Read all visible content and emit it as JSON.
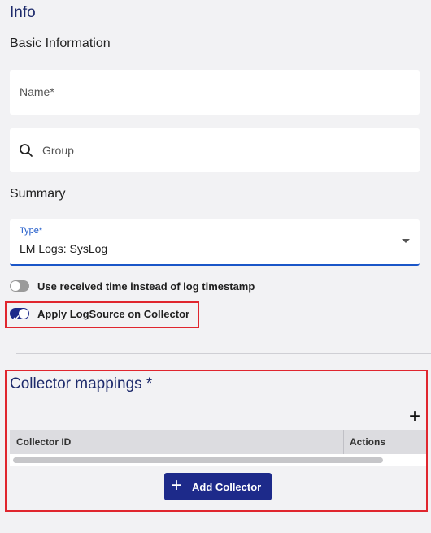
{
  "info": {
    "title": "Info",
    "basic_information": "Basic Information",
    "name_placeholder": "Name*",
    "group_placeholder": "Group",
    "summary": "Summary",
    "type_label": "Type*",
    "type_value": "LM Logs: SysLog",
    "toggle_received_time": {
      "label": "Use received time instead of log timestamp",
      "enabled": false
    },
    "toggle_apply_logsource": {
      "label": "Apply LogSource on Collector",
      "enabled": true
    }
  },
  "collector_mappings": {
    "title": "Collector mappings *",
    "columns": [
      "Collector ID",
      "Actions"
    ],
    "rows": [],
    "add_button_label": "Add Collector"
  },
  "colors": {
    "accent": "#1d2a8a",
    "focus": "#1a56c8",
    "highlight": "#e0262e"
  },
  "icons": {
    "group_field": "search-icon",
    "type_field": "dropdown-caret-icon",
    "add_row": "plus-icon"
  }
}
